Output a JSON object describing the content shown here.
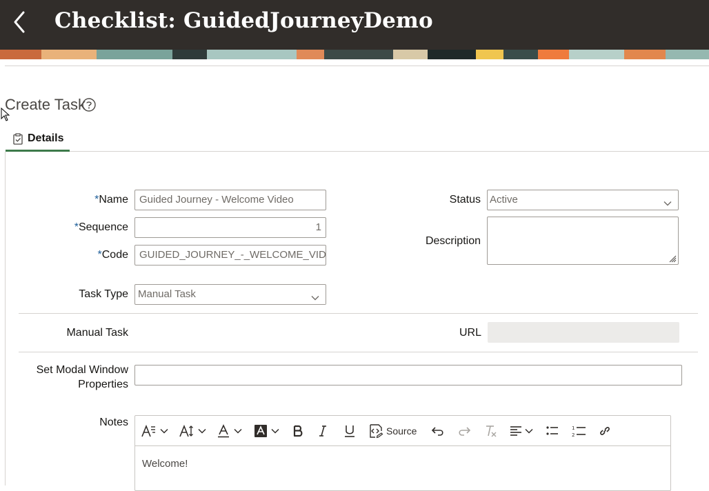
{
  "header": {
    "title": "Checklist: GuidedJourneyDemo"
  },
  "section": {
    "title": "Create Task"
  },
  "tabs": [
    {
      "label": "Details"
    }
  ],
  "form": {
    "name": {
      "label": "Name",
      "required_mark": "*",
      "value": "Guided Journey - Welcome Video"
    },
    "sequence": {
      "label": "Sequence",
      "required_mark": "*",
      "value": "1"
    },
    "code": {
      "label": "Code",
      "required_mark": "*",
      "value": "GUIDED_JOURNEY_-_WELCOME_VIDEC"
    },
    "task_type": {
      "label": "Task Type",
      "value": "Manual Task"
    },
    "status": {
      "label": "Status",
      "value": "Active"
    },
    "description": {
      "label": "Description",
      "value": ""
    },
    "manual_task": {
      "label": "Manual Task"
    },
    "url": {
      "label": "URL",
      "value": ""
    },
    "modal_window": {
      "label_line1": "Set Modal Window",
      "label_line2": "Properties",
      "value": ""
    },
    "notes": {
      "label": "Notes",
      "value": "Welcome!"
    }
  },
  "editor_toolbar": {
    "source_label": "Source"
  },
  "colors": {
    "header_bg": "#312d2a",
    "tab_underline": "#3d7a4a",
    "required": "#1f5f9a"
  }
}
